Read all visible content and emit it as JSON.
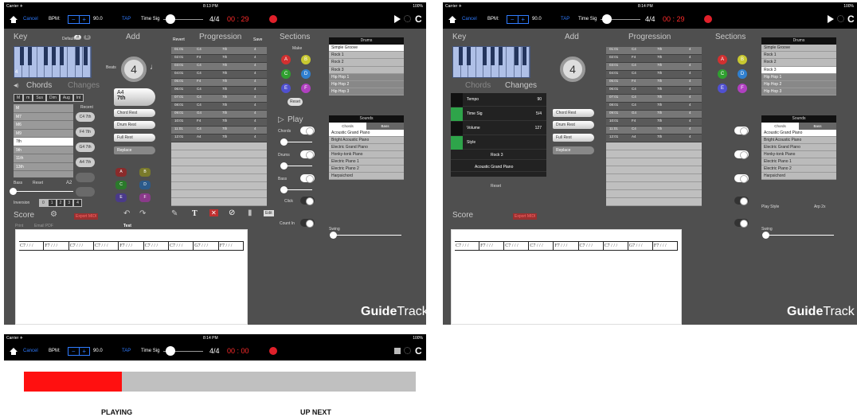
{
  "screen1": {
    "status": {
      "carrier": "Carrier ✈",
      "time": "8:13 PM",
      "battery": "100%"
    },
    "topbar": {
      "cancel": "Cancel",
      "bpm_label": "BPM:",
      "bpm_value": "90.0",
      "tap": "TAP",
      "timesig_label": "Time Sig",
      "timesig_value": "4/4",
      "time_display": "00 : 29"
    },
    "key": {
      "title": "Key",
      "default": "Default",
      "sharp": "#",
      "flat": "b",
      "key_num": "4"
    },
    "add": {
      "title": "Add",
      "beats_label": "Beats",
      "beats_value": "4",
      "current_chord": "A4",
      "current_type": "7th",
      "buttons": [
        "Chord Rest",
        "Drum Rest",
        "Full Rest",
        "Replace"
      ]
    },
    "chords": {
      "tab_chords": "Chords",
      "tab_changes": "Changes",
      "qualities": [
        "M",
        "m",
        "Sus",
        "Dim",
        "Aug",
        "Int"
      ],
      "types": [
        "M",
        "M7",
        "M6",
        "M9",
        "7th",
        "9th",
        "11th",
        "13th"
      ],
      "selected_type": "7th",
      "recent_label": "Recent",
      "recent": [
        "C4 7th",
        "F4 7th",
        "G4 7th",
        "A4 7th"
      ],
      "bass_label": "Bass",
      "reset": "Reset",
      "bass_value": "A2",
      "inversion_label": "Inversion",
      "inversions": [
        "0",
        "1",
        "2",
        "3",
        "4"
      ]
    },
    "progression": {
      "revert": "Revert",
      "title": "Progression",
      "save": "Save",
      "rows": [
        [
          "01:01",
          "C4",
          "7th",
          "4"
        ],
        [
          "02:01",
          "F4",
          "7th",
          "4"
        ],
        [
          "03:01",
          "C4",
          "7th",
          "4"
        ],
        [
          "04:01",
          "C4",
          "7th",
          "4"
        ],
        [
          "05:01",
          "F4",
          "7th",
          "4"
        ],
        [
          "06:01",
          "C4",
          "7th",
          "4"
        ],
        [
          "07:01",
          "C4",
          "7th",
          "4"
        ],
        [
          "08:01",
          "C4",
          "7th",
          "4"
        ],
        [
          "09:01",
          "G4",
          "7th",
          "4"
        ],
        [
          "10:01",
          "F4",
          "7th",
          "4"
        ],
        [
          "11:01",
          "C4",
          "7th",
          "4"
        ],
        [
          "12:01",
          "A4",
          "7th",
          "4"
        ]
      ]
    },
    "sections": {
      "title": "Sections",
      "make": "Make",
      "letters": [
        "A",
        "B",
        "C",
        "D",
        "E",
        "F"
      ],
      "reset": "Reset",
      "play": "Play",
      "toggles": [
        "Chords",
        "Drums",
        "Bass",
        "Click",
        "Count In"
      ],
      "edit": "Edit"
    },
    "drums": {
      "title": "Drums",
      "items": [
        "Simple Groove",
        "Rock 1",
        "Rock 2",
        "Rock 3",
        "Hip Hop 1",
        "Hip Hop 2",
        "Hip Hop 3"
      ],
      "selected": "Simple Groove"
    },
    "sounds": {
      "title": "Sounds",
      "tab_chords": "Chords",
      "tab_bass": "Bass",
      "items": [
        "Acoustic Grand Piano",
        "Bright Acoustic Piano",
        "Electric Grand Piano",
        "Honky-tonk Piano",
        "Electric Piano 1",
        "Electric Piano 2",
        "Harpsichord"
      ]
    },
    "swing": "Swing",
    "score": {
      "title": "Score",
      "export": "Export MIDI",
      "print": "Print",
      "email": "Email PDF",
      "doc_title": "Test",
      "measures": [
        "C7 / / /",
        "F7 / / /",
        "C7 / / /",
        "C7 / / /",
        "F7 / / /",
        "C7 / / /",
        "C7 / / /",
        "G7 / / /",
        "F7 / / /"
      ]
    },
    "logo": {
      "bold": "Guide",
      "light": "Track"
    }
  },
  "screen2": {
    "status": {
      "carrier": "Carrier ✈",
      "time": "8:14 PM",
      "battery": "100%"
    },
    "topbar": {
      "cancel": "Cancel",
      "bpm_label": "BPM:",
      "bpm_value": "90.0",
      "tap": "TAP",
      "timesig_label": "Time Sig",
      "timesig_value": "4/4",
      "time_display": "00 : 29"
    },
    "key_title": "Key",
    "add_title": "Add",
    "progression_title": "Progression",
    "sections_title": "Sections",
    "changes": {
      "tab_chords": "Chords",
      "tab_changes": "Changes",
      "tempo_label": "Tempo",
      "tempo_value": "90",
      "timesig_label": "Time Sig",
      "timesig_value": "5/4",
      "volume_label": "Volume",
      "volume_value": "127",
      "style_label": "Style",
      "drum_name": "Rock 3",
      "sound_name": "Acoustic Grand Piano",
      "reset": "Reset"
    },
    "drums": {
      "title": "Drums",
      "items": [
        "Simple Groove",
        "Rock 1",
        "Rock 2",
        "Rock 3",
        "Hip Hop 1",
        "Hip Hop 2",
        "Hip Hop 3"
      ],
      "selected": "Rock 3"
    },
    "sounds": {
      "title": "Sounds",
      "tab_chords": "Chords",
      "tab_bass": "Bass",
      "items": [
        "Acoustic Grand Piano",
        "Bright Acoustic Piano",
        "Electric Grand Piano",
        "Honky-tonk Piano",
        "Electric Piano 1",
        "Electric Piano 2",
        "Harpsichord"
      ]
    },
    "play_style_label": "Play Style",
    "arp": "Arp 2x",
    "swing": "Swing",
    "score_title": "Score",
    "export": "Export MIDI",
    "logo": {
      "bold": "Guide",
      "light": "Track"
    }
  },
  "screen3": {
    "status": {
      "carrier": "Carrier ✈",
      "time": "8:14 PM",
      "battery": "100%"
    },
    "topbar": {
      "cancel": "Cancel",
      "bpm_label": "BPM:",
      "bpm_value": "90.0",
      "tap": "TAP",
      "timesig_label": "Time Sig",
      "timesig_value": "4/4",
      "time_display": "00 : 00"
    },
    "progress_fraction": 0.25,
    "playing": "PLAYING",
    "up_next": "UP NEXT"
  },
  "colors": {
    "accent": "#2f7bff",
    "record": "#e0202a",
    "progress": "#ff1010"
  }
}
